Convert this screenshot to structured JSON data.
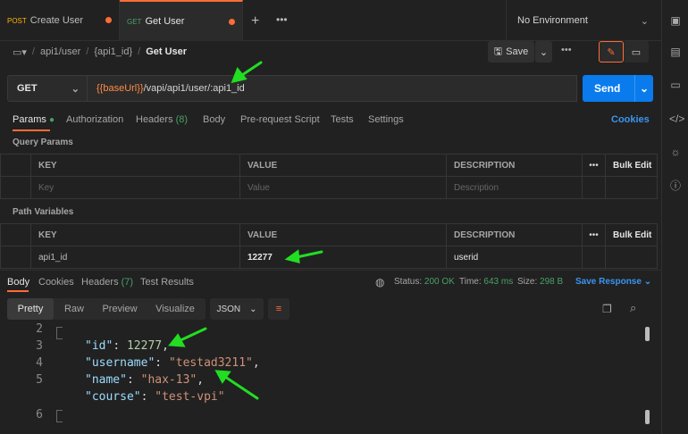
{
  "tabs": [
    {
      "method": "POST",
      "label": "Create User"
    },
    {
      "method": "GET",
      "label": "Get User"
    }
  ],
  "environment": "No Environment",
  "breadcrumb": {
    "part1": "api1/user",
    "part2": "{api1_id}",
    "current": "Get User"
  },
  "save_label": "Save",
  "method": "GET",
  "url": {
    "var": "{{baseUrl}}",
    "rest": "/vapi/api1/user/:api1_id"
  },
  "send_label": "Send",
  "req_tabs": {
    "params": "Params",
    "authorization": "Authorization",
    "headers": "Headers",
    "headers_count": "(8)",
    "body": "Body",
    "prerequest": "Pre-request Script",
    "tests": "Tests",
    "settings": "Settings",
    "cookies": "Cookies"
  },
  "query_params": {
    "label": "Query Params",
    "h_key": "KEY",
    "h_value": "VALUE",
    "h_desc": "DESCRIPTION",
    "bulk": "Bulk Edit",
    "ph_key": "Key",
    "ph_value": "Value",
    "ph_desc": "Description"
  },
  "path_vars": {
    "label": "Path Variables",
    "h_key": "KEY",
    "h_value": "VALUE",
    "h_desc": "DESCRIPTION",
    "bulk": "Bulk Edit",
    "key": "api1_id",
    "value": "12277",
    "desc": "userid"
  },
  "resp_tabs": {
    "body": "Body",
    "cookies": "Cookies",
    "headers": "Headers",
    "headers_count": "(7)",
    "test_results": "Test Results"
  },
  "status": {
    "status_label": "Status:",
    "status": "200 OK",
    "time_label": "Time:",
    "time": "643 ms",
    "size_label": "Size:",
    "size": "298 B",
    "save_response": "Save Response"
  },
  "formats": {
    "pretty": "Pretty",
    "raw": "Raw",
    "preview": "Preview",
    "visualize": "Visualize",
    "json": "JSON"
  },
  "code": {
    "ln2": "2",
    "ln3": "3",
    "ln4": "4",
    "ln5": "5",
    "ln6": "6",
    "k_id": "\"id\"",
    "v_id": "12277",
    "k_username": "\"username\"",
    "v_username": "\"testad3211\"",
    "k_name": "\"name\"",
    "v_name": "\"hax-13\"",
    "k_course": "\"course\"",
    "v_course": "\"test-vpi\""
  },
  "colors": {
    "accent": "#ff6c37",
    "send": "#097bed",
    "arrow": "#22dd22",
    "status_ok": "#49a067"
  }
}
